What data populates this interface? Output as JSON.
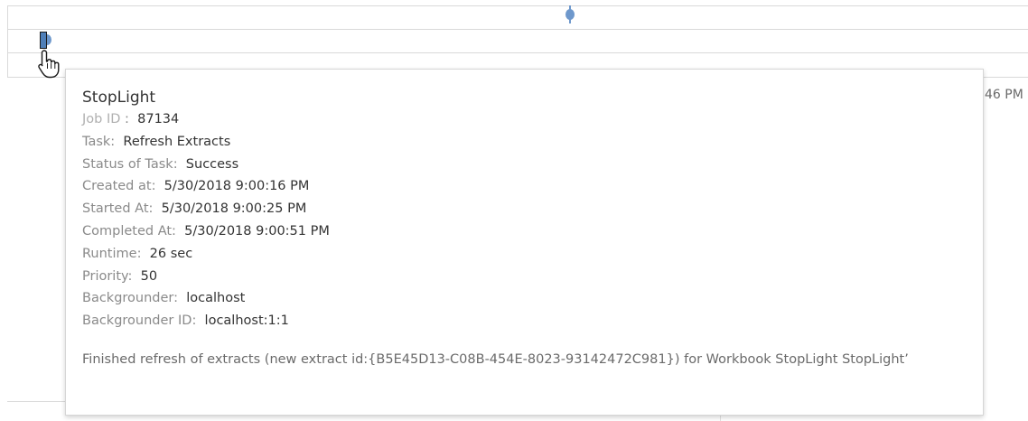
{
  "background": {
    "edge_text": "46 PM"
  },
  "tooltip": {
    "title": "StopLight",
    "fields": [
      {
        "label": "Job ID",
        "sep": " :  ",
        "value": "87134"
      },
      {
        "label": "Task:",
        "sep": "  ",
        "value": "Refresh Extracts"
      },
      {
        "label": "Status of Task:",
        "sep": "  ",
        "value": "Success"
      },
      {
        "label": "Created at:",
        "sep": "  ",
        "value": "5/30/2018 9:00:16 PM"
      },
      {
        "label": "Started At:",
        "sep": "  ",
        "value": "5/30/2018 9:00:25 PM"
      },
      {
        "label": "Completed At:",
        "sep": "  ",
        "value": "5/30/2018 9:00:51 PM"
      },
      {
        "label": "Runtime:",
        "sep": "  ",
        "value": "26 sec"
      },
      {
        "label": "Priority:",
        "sep": "  ",
        "value": "50"
      },
      {
        "label": "Backgrounder:",
        "sep": "  ",
        "value": "localhost"
      },
      {
        "label": "Backgrounder ID:",
        "sep": "  ",
        "value": "localhost:1:1"
      }
    ],
    "message": "Finished refresh of extracts (new extract id:{B5E45D13-C08B-454E-8023-93142472C981}) for Workbook StopLight StopLight’"
  },
  "colors": {
    "mark": "#6e98cc",
    "mark_selected": "#4f7fb8",
    "label": "#8a8a8a",
    "value": "#333333"
  },
  "icons": {
    "cursor": "hand-pointer-icon"
  }
}
